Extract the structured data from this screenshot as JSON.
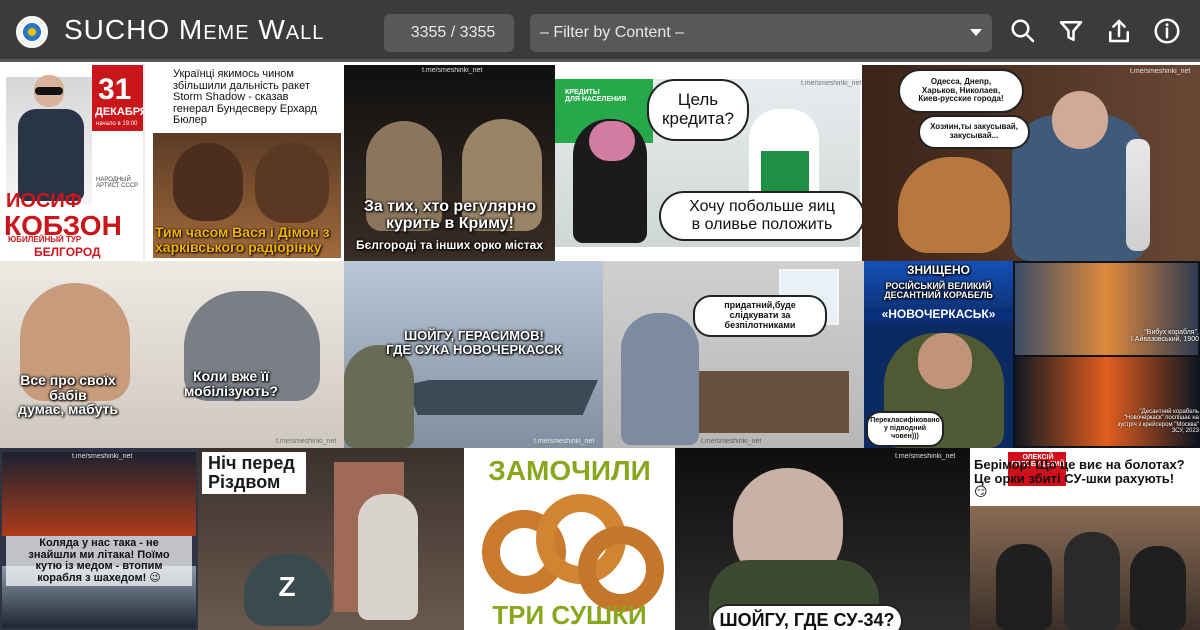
{
  "header": {
    "title": "SUCHO Meme Wall",
    "count_text": "3355 / 3355",
    "filter_placeholder": "– Filter by Content –",
    "icons": [
      "search-icon",
      "filter-icon",
      "share-icon",
      "info-icon"
    ]
  },
  "tiles": [
    {
      "id": "kobzon",
      "name": "meme-tile-kobzon",
      "captions": {
        "date": "31",
        "month": "ДЕКАБРЯ",
        "time": "начало в 19:00",
        "name_small": "ИОСИФ",
        "name_big": "КОБЗОН",
        "tour": "ЮБИЛЕЙНЫЙ ТУР",
        "city": "БЕЛГОРОД",
        "rank": "НАРОДНЫЙ\nАРТИСТ СССР"
      }
    },
    {
      "id": "dogs",
      "name": "meme-tile-dogs",
      "captions": {
        "top": "Українці якимось чином\nзбільшили дальність ракет\nStorm Shadow - сказав\nгенерал Бундесверу Ерхард\nБюлер",
        "bottom": "Тим часом Вася і Дімон з\nхарківського радіорінку"
      }
    },
    {
      "id": "crimea",
      "name": "meme-tile-crimea-toast",
      "captions": {
        "main": "За тих, хто регулярно\nкурить в Криму!",
        "sub": "Бєлгороді та інших орко містах",
        "wm": "t.me/smeshinki_net"
      }
    },
    {
      "id": "credit",
      "name": "meme-tile-bank-credit",
      "captions": {
        "q": "Цель\nкредита?",
        "a": "Хочу побольше яиц\nв оливье положить",
        "sign": "КРЕДИТЫ\nДЛЯ НАСЕЛЕНИЯ",
        "wm": "t.me/smeshinki_net"
      }
    },
    {
      "id": "medvedev",
      "name": "meme-tile-medvedev-dog",
      "captions": {
        "top": "Одесса, Днепр,\nХарьков, Николаев,\nКиев-русские города!",
        "mid": "Хозяин,ты закусывай,\nзакусывай...",
        "wm": "t.me/smeshinki_net"
      }
    },
    {
      "id": "bed",
      "name": "meme-tile-bed",
      "captions": {
        "left": "Все про своїх бабів\nдумає, мабуть",
        "right": "Коли вже її\nмобілізують?",
        "wm": "t.me/smeshinki_net"
      }
    },
    {
      "id": "ship",
      "name": "meme-tile-ship",
      "captions": {
        "main": "ШОЙГУ, ГЕРАСИМОВ!\nГДЕ СУКА НОВОЧЕРКАССК",
        "wm": "t.me/smeshinki_net"
      }
    },
    {
      "id": "office",
      "name": "meme-tile-office",
      "captions": {
        "main": "придатний,буде\nслідкувати за\nбезпілотниками",
        "wm": "t.me/smeshinki_net"
      }
    },
    {
      "id": "zaluzhny",
      "name": "meme-tile-zaluzhny",
      "captions": {
        "h1": "ЗНИЩЕНО",
        "h2": "РОСІЙСЬКИЙ ВЕЛИКИЙ\nДЕСАНТНИЙ КОРАБЕЛЬ",
        "h3": "«НОВОЧЕРКАСЬК»",
        "bubble": "\"Перекласифіковано\"\nу підводний\nчовен)))"
      }
    },
    {
      "id": "aivazovsky",
      "name": "meme-tile-aivazovsky",
      "captions": {
        "top": "\"Вибух корабля\",\nІ.Айвазовський, 1900",
        "bottom": "\"Десантний корабель\n\"Новочеркаск\" поспішає на\nзустріч з крейсером \"Москва\"\nЗСУ, 2023"
      }
    },
    {
      "id": "koliada",
      "name": "meme-tile-koliada",
      "captions": {
        "main": "Коляда у нас така - не\nзнайшли ми літака! Поїмо\nкутю із медом - втопим\nкорабля з шахедом! 😉",
        "wm": "t.me/smeshinki_net"
      }
    },
    {
      "id": "christmas",
      "name": "meme-tile-christmas-eve",
      "captions": {
        "main": "Ніч перед\nРіздвом",
        "z": "Z"
      }
    },
    {
      "id": "sushki",
      "name": "meme-tile-sushki",
      "captions": {
        "top": "ЗАМОЧИЛИ",
        "bottom": "ТРИ СУШКИ"
      }
    },
    {
      "id": "prigozhin",
      "name": "meme-tile-prigozhin",
      "captions": {
        "main": "ШОЙГУ, ГДЕ СУ-34?",
        "wm": "t.me/smeshinki_net"
      }
    },
    {
      "id": "barrymore",
      "name": "meme-tile-barrymore",
      "captions": {
        "badge": "ОЛЕКСІЙ\nГОЛОБУЦЬКИЙ",
        "text": "Берімор! Що це виє на болотах?\nЦе орки збиті СУ-шки рахують!\n😏"
      }
    }
  ]
}
